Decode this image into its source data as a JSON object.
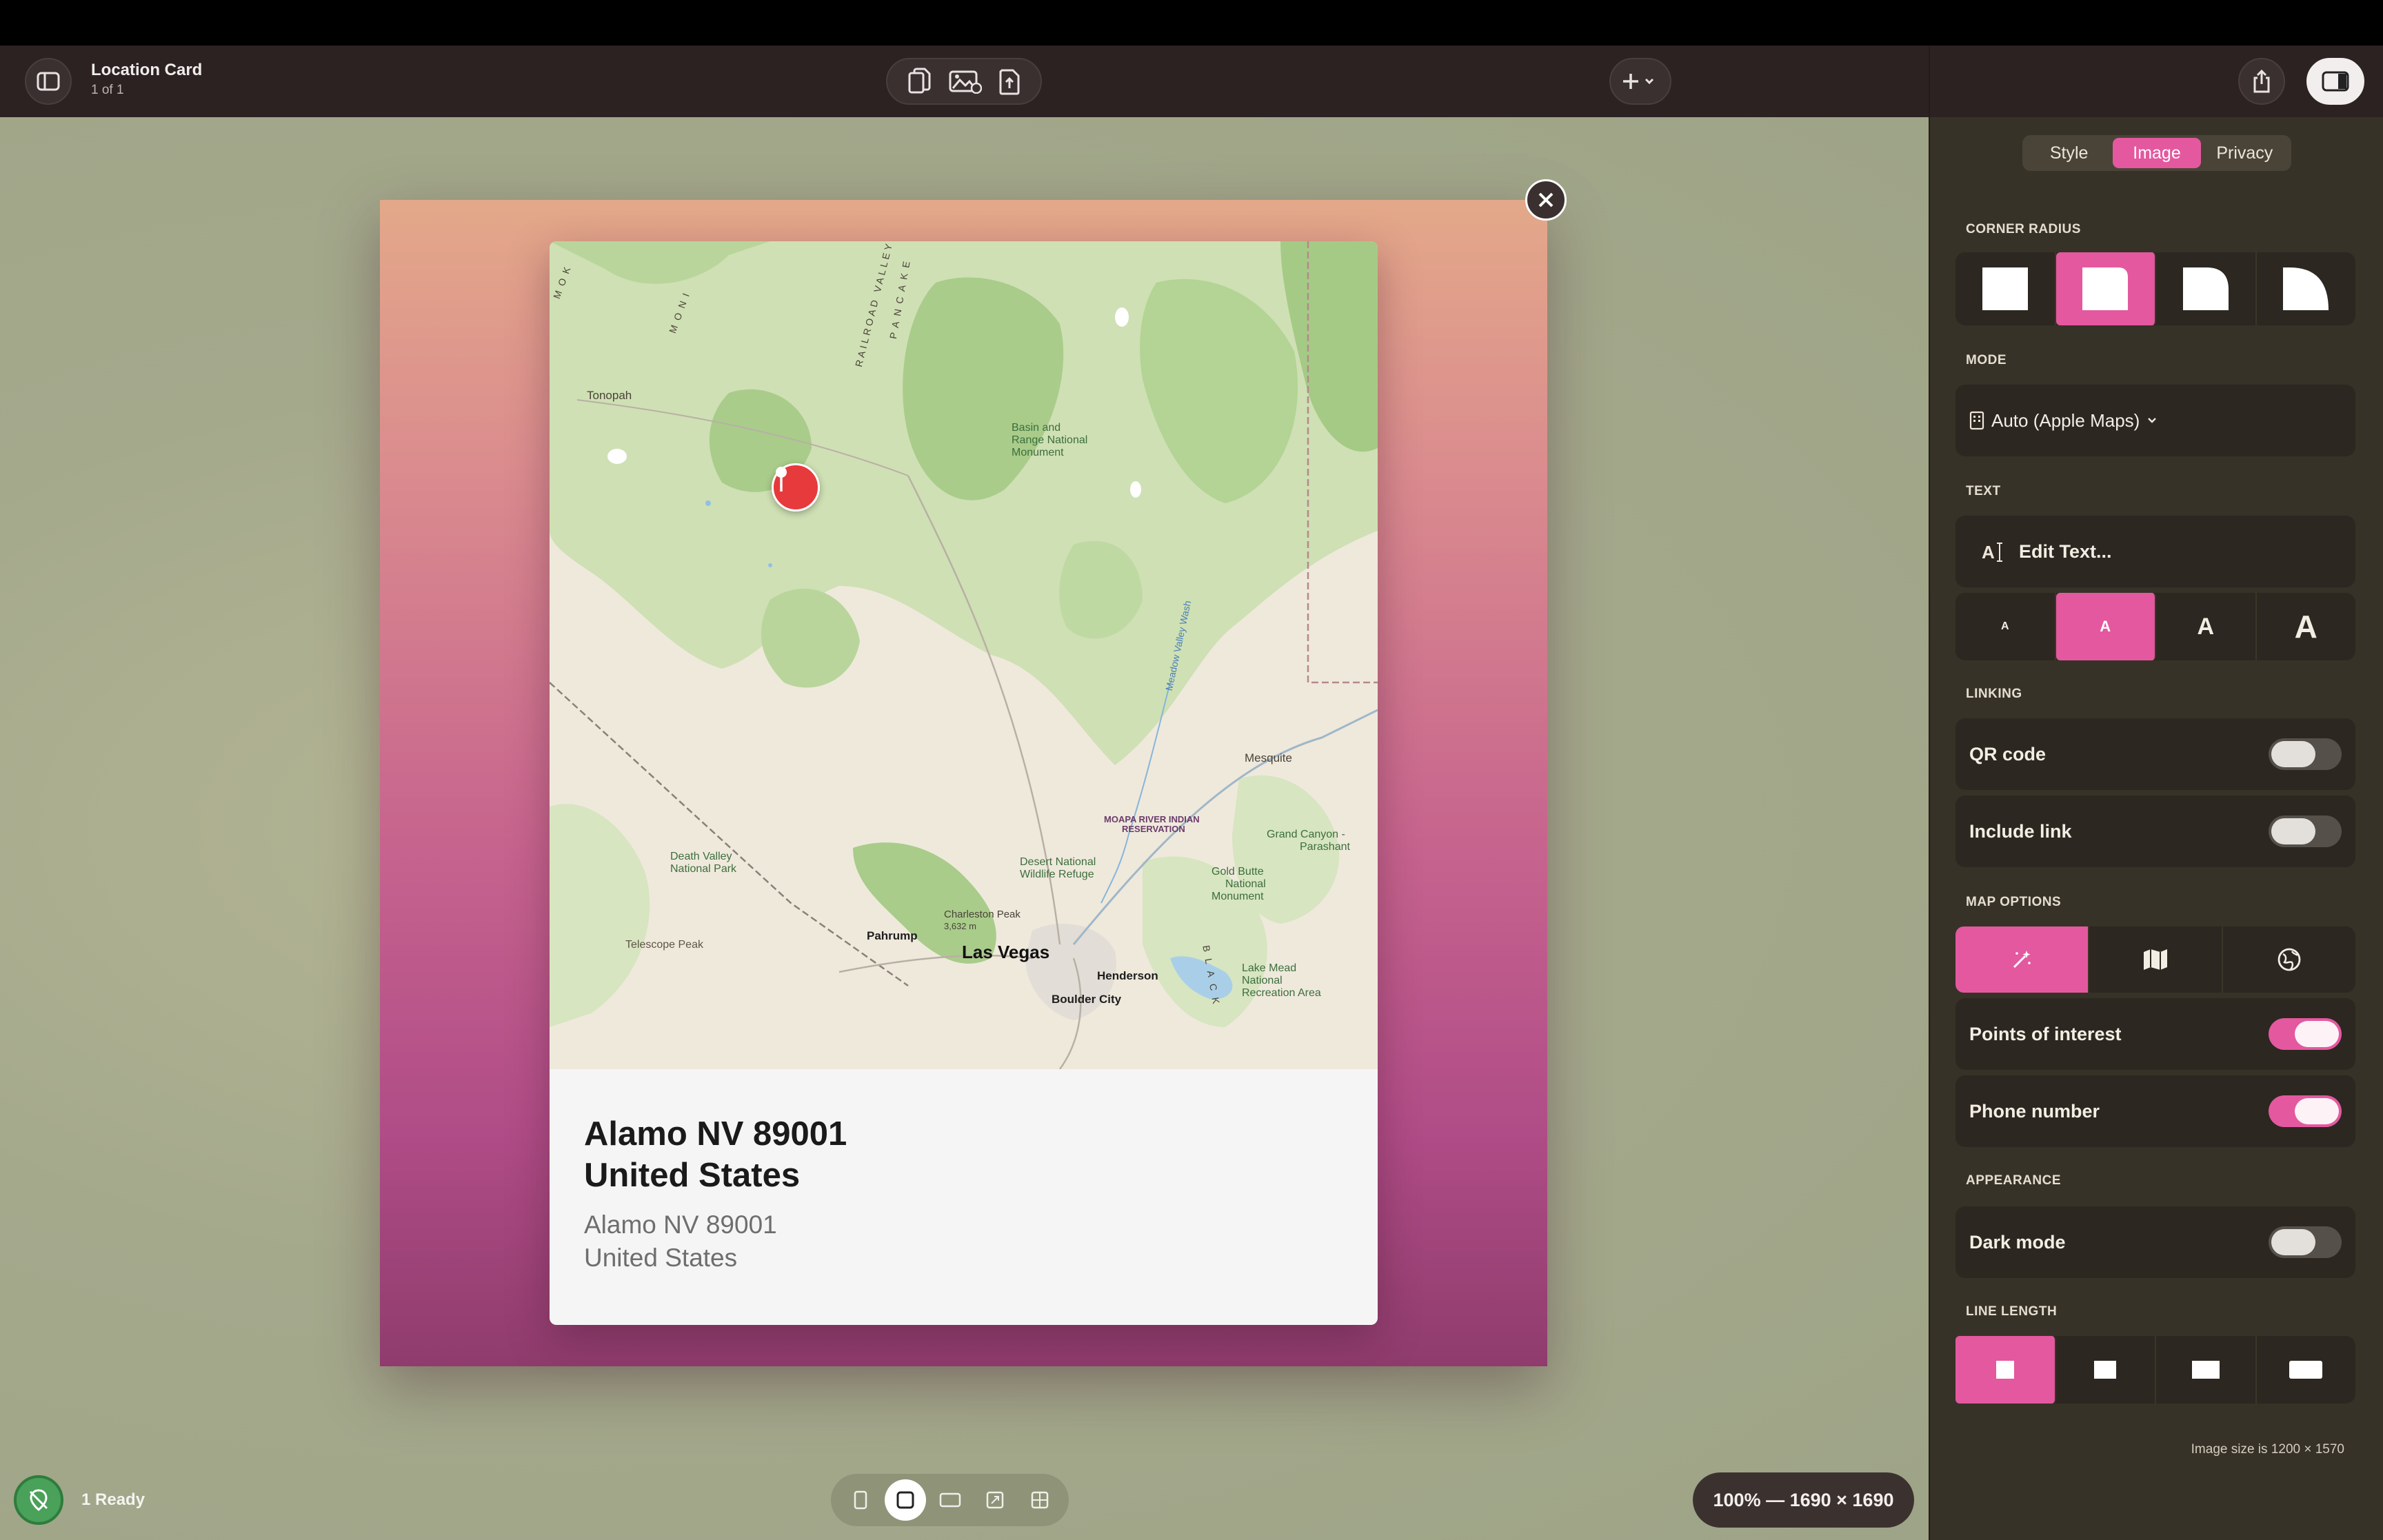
{
  "toolbar": {
    "document_title": "Location Card",
    "page_count": "1 of 1"
  },
  "card": {
    "title_line1": "Alamo NV 89001",
    "title_line2": "United States",
    "subtitle_line1": "Alamo NV 89001",
    "subtitle_line2": "United States"
  },
  "map_labels": {
    "tonopah": "Tonopah",
    "basin_range_1": "Basin and",
    "basin_range_2": "Range National",
    "basin_range_3": "Monument",
    "railroad_valley": "RAILROAD VALLEY",
    "pancake": "PANCAKE",
    "monitor": "MONI",
    "mok": "MOK",
    "meadow_valley_wash": "Meadow Valley Wash",
    "mesquite": "Mesquite",
    "moapa_1": "MOAPA RIVER INDIAN",
    "moapa_2": "RESERVATION",
    "grand_canyon_1": "Grand Canyon -",
    "grand_canyon_2": "Parashant",
    "death_valley_1": "Death Valley",
    "death_valley_2": "National Park",
    "desert_nwr_1": "Desert National",
    "desert_nwr_2": "Wildlife Refuge",
    "gold_butte_1": "Gold Butte",
    "gold_butte_2": "National",
    "gold_butte_3": "Monument",
    "charleston_1": "Charleston Peak",
    "charleston_2": "3,632 m",
    "pahrump": "Pahrump",
    "las_vegas": "Las Vegas",
    "henderson": "Henderson",
    "boulder_city": "Boulder City",
    "telescope_peak": "Telescope Peak",
    "lake_mead_1": "Lake Mead",
    "lake_mead_2": "National",
    "lake_mead_3": "Recreation Area",
    "black": "BLACK"
  },
  "status": {
    "text": "1 Ready"
  },
  "zoom": {
    "text": "100% — 1690 × 1690"
  },
  "sidebar": {
    "tabs": [
      {
        "label": "Style",
        "active": false
      },
      {
        "label": "Image",
        "active": true
      },
      {
        "label": "Privacy",
        "active": false
      }
    ],
    "corner_radius_label": "CORNER RADIUS",
    "mode_label": "MODE",
    "mode_value": "Auto (Apple Maps)",
    "text_label": "TEXT",
    "edit_text_label": "Edit Text...",
    "text_sizes": [
      "A",
      "A",
      "A",
      "A"
    ],
    "linking_label": "LINKING",
    "qr_code_label": "QR code",
    "qr_code_on": false,
    "include_link_label": "Include link",
    "include_link_on": false,
    "map_options_label": "MAP OPTIONS",
    "points_of_interest_label": "Points of interest",
    "points_of_interest_on": true,
    "phone_number_label": "Phone number",
    "phone_number_on": true,
    "appearance_label": "APPEARANCE",
    "dark_mode_label": "Dark mode",
    "dark_mode_on": false,
    "line_length_label": "LINE LENGTH",
    "image_size_text": "Image size is 1200 × 1570"
  },
  "colors": {
    "accent": "#e4589f",
    "pin": "#e63a3c",
    "status_green": "#4aa159"
  }
}
